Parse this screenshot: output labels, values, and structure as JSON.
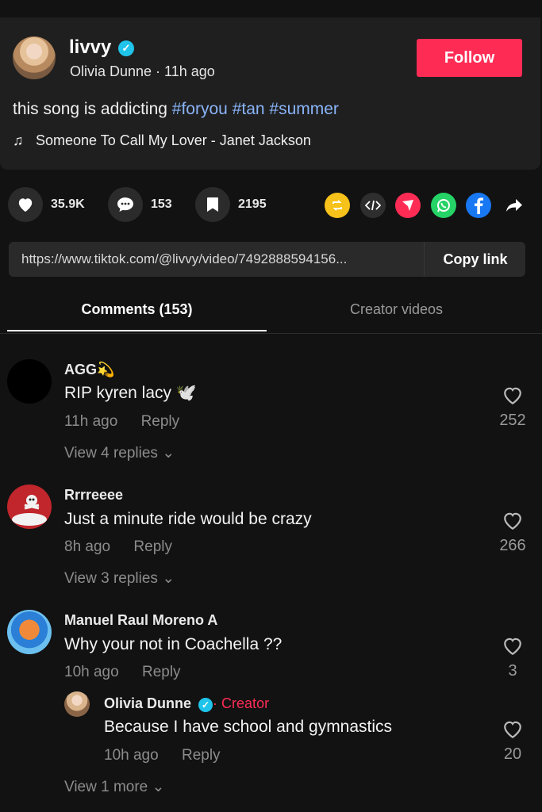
{
  "post": {
    "username": "livvy",
    "author_line": "Olivia Dunne · 11h ago",
    "follow_label": "Follow",
    "caption_text": "this song is addicting",
    "hashtags": [
      "#foryou",
      "#tan",
      "#summer"
    ],
    "music": "Someone To Call My Lover - Janet Jackson"
  },
  "stats": {
    "likes": "35.9K",
    "comments": "153",
    "saves": "2195"
  },
  "share_icons": [
    "repost-icon",
    "embed-icon",
    "send-icon",
    "whatsapp-icon",
    "facebook-icon",
    "share-arrow-icon"
  ],
  "link": {
    "url": "https://www.tiktok.com/@livvy/video/7492888594156...",
    "copy_label": "Copy link"
  },
  "tabs": {
    "comments": "Comments (153)",
    "creator_videos": "Creator videos"
  },
  "comments": [
    {
      "name": "AGG💫",
      "text": "RIP kyren lacy 🕊️",
      "time": "11h ago",
      "reply": "Reply",
      "likes": "252",
      "view_replies": "View 4 replies"
    },
    {
      "name": "Rrrreeee",
      "text": "Just a minute ride would be crazy",
      "time": "8h ago",
      "reply": "Reply",
      "likes": "266",
      "view_replies": "View 3 replies"
    },
    {
      "name": "Manuel Raul Moreno A",
      "text": "Why your not in Coachella ??",
      "time": "10h ago",
      "reply": "Reply",
      "likes": "3"
    }
  ],
  "reply": {
    "name": "Olivia Dunne",
    "creator_label": "Creator",
    "text": "Because I have school and gymnastics",
    "time": "10h ago",
    "reply": "Reply",
    "likes": "20",
    "view_more": "View 1 more"
  },
  "colors": {
    "accent": "#fe2c55",
    "hashtag": "#8ab4f8",
    "verified": "#20c4eb"
  }
}
